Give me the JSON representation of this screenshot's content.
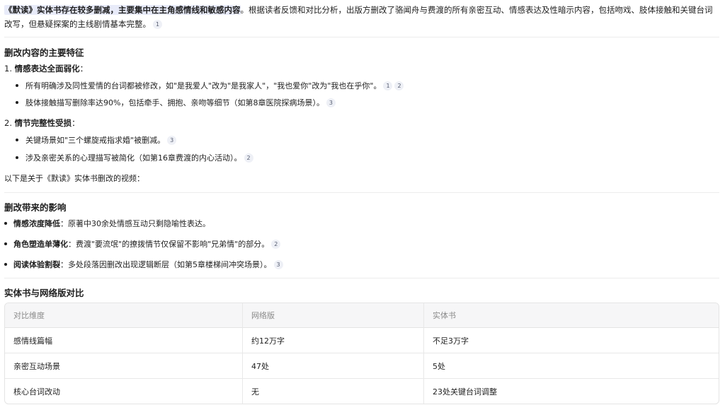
{
  "intro": {
    "highlight": "《默读》实体书存在较多删减，主要集中在主角感情线和敏感内容",
    "rest": "。根据读者反馈和对比分析，出版方删改了骆闻舟与费渡的所有亲密互动、情感表达及性暗示内容，包括吻戏、肢体接触和关键台词改写，但悬疑探案的主线剧情基本完整。",
    "cite": "1"
  },
  "section1": {
    "title": "删改内容的主要特征",
    "item1": {
      "number": "1.",
      "title": "情感表达全面弱化",
      "suffix": "：",
      "bullets": [
        {
          "text": "所有明确涉及同性爱情的台词都被修改，如\"是我爱人\"改为\"是我家人\"，\"我也爱你\"改为\"我也在乎你\"。",
          "cites": [
            "1",
            "2"
          ]
        },
        {
          "text": "肢体接触描写删除率达90%，包括牵手、拥抱、亲吻等细节（如第8章医院探病场景）。",
          "cites": [
            "3"
          ]
        }
      ]
    },
    "item2": {
      "number": "2.",
      "title": "情节完整性受损",
      "suffix": "：",
      "bullets": [
        {
          "text": "关键场景如\"三个螺旋戒指求婚\"被删减。",
          "cites": [
            "3"
          ]
        },
        {
          "text": "涉及亲密关系的心理描写被简化（如第16章费渡的内心活动）。",
          "cites": [
            "2"
          ]
        }
      ]
    },
    "video_line": "以下是关于《默读》实体书删改的视频："
  },
  "section2": {
    "title": "删改带来的影响",
    "bullets": [
      {
        "bold": "情感浓度降低",
        "text": "：原著中30余处情感互动只剩隐喻性表达。",
        "cites": []
      },
      {
        "bold": "角色塑造单薄化",
        "text": "：费渡\"要流氓\"的撩拨情节仅保留不影响\"兄弟情\"的部分。",
        "cites": [
          "2"
        ]
      },
      {
        "bold": "阅读体验割裂",
        "text": "：多处段落因删改出现逻辑断层（如第5章楼梯间冲突场景）。",
        "cites": [
          "3"
        ]
      }
    ]
  },
  "section3": {
    "title": "实体书与网络版对比",
    "table": {
      "headers": [
        "对比维度",
        "网络版",
        "实体书"
      ],
      "rows": [
        [
          "感情线篇幅",
          "约12万字",
          "不足3万字"
        ],
        [
          "亲密互动场景",
          "47处",
          "5处"
        ],
        [
          "核心台词改动",
          "无",
          "23处关键台词调整"
        ]
      ]
    }
  }
}
